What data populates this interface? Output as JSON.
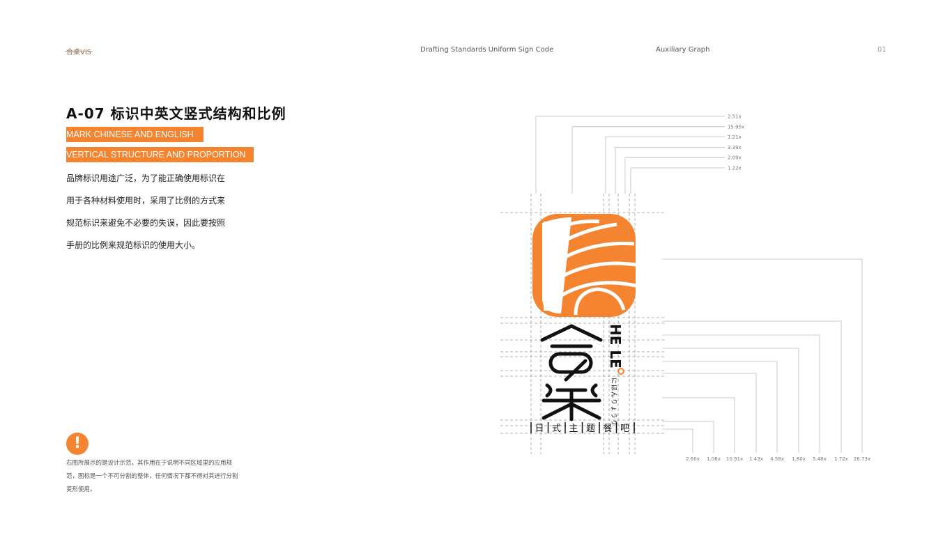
{
  "header": {
    "brand": "合桌VIS",
    "center": "Drafting Standards Uniform Sign Code",
    "section": "Auxiliary  Graph",
    "page": "01"
  },
  "main": {
    "title": "A-07  标识中英文竖式结构和比例",
    "subtitle_lines": [
      "MARK CHINESE AND ENGLISH",
      "VERTICAL STRUCTURE AND PROPORTION"
    ],
    "body_lines": [
      "品牌标识用途广泛，为了能正确使用标识在",
      "用于各种材料使用时，采用了比例的方式来",
      "规范标识来避免不必要的失误，因此要按照",
      "手册的比例来规范标识的使用大小。"
    ]
  },
  "note": {
    "icon": "exclamation-icon",
    "text": "右图所展示的是设计示范，其作用在于说明不同区域里的应用规范，图标是一个不可分割的整体，任何情况下都不得对其进行分割变形使用。"
  },
  "logo": {
    "english": "HE LE",
    "kana": "にほんりょうり",
    "tagline": [
      "日",
      "式",
      "主",
      "题",
      "餐",
      "吧"
    ],
    "chinese": "合桌"
  },
  "ratios_top": [
    "2.51x",
    "15.95x",
    "1.21x",
    "3.39x",
    "2.09x",
    "1.22x"
  ],
  "ratios_bottom": [
    "2.60x",
    "1.06x",
    "10.91x",
    "1.43x",
    "4.58x",
    "1.80x",
    "5.46x",
    "1.72x",
    "26.73x"
  ],
  "colors": {
    "accent": "#f58430",
    "text": "#111111"
  }
}
